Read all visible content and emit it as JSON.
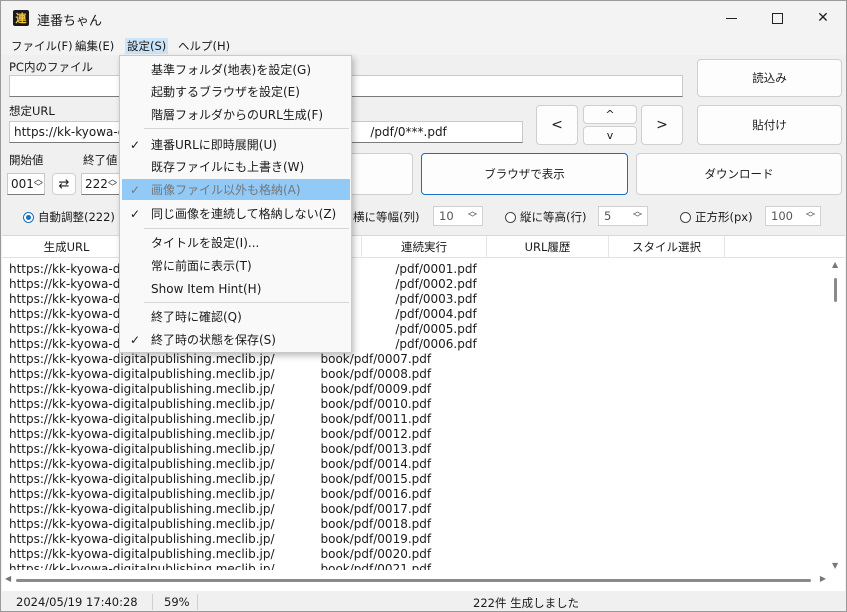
{
  "window": {
    "icon_char": "連",
    "title": "連番ちゃん"
  },
  "menubar": {
    "file": "ファイル(F)",
    "edit": "編集(E)",
    "settings": "設定(S)",
    "help": "ヘルプ(H)"
  },
  "form": {
    "pc_file_label": "PC内のファイル",
    "pc_file_value": "",
    "url_label": "想定URL",
    "url_value_left": "https://kk-kyowa-d",
    "url_value_right": "/pdf/0***.pdf",
    "start_label": "開始値",
    "start_value": "001",
    "end_label": "終了値",
    "end_value": "222",
    "swap_icon": "⇄"
  },
  "buttons": {
    "load": "読込み",
    "paste": "貼付け",
    "prev": "<",
    "up": "^",
    "down": "v",
    "next": ">",
    "browser": "ブラウザで表示",
    "download": "ダウンロード"
  },
  "layout_options": {
    "auto": "自動調整(222)",
    "equal_width_label": "横に等幅(列)",
    "equal_width_value": "10",
    "equal_height_label": "縦に等高(行)",
    "equal_height_value": "5",
    "square_label": "正方形(px)",
    "square_value": "100"
  },
  "table": {
    "columns": [
      "生成URL",
      "連続実行",
      "URL履歴",
      "スタイル選択"
    ],
    "rows_left": [
      "https://kk-kyowa-d",
      "https://kk-kyowa-d",
      "https://kk-kyowa-d",
      "https://kk-kyowa-d",
      "https://kk-kyowa-d",
      "https://kk-kyowa-d",
      "https://kk-kyowa-digitalpublishing.meclib.jp/",
      "https://kk-kyowa-digitalpublishing.meclib.jp/",
      "https://kk-kyowa-digitalpublishing.meclib.jp/",
      "https://kk-kyowa-digitalpublishing.meclib.jp/",
      "https://kk-kyowa-digitalpublishing.meclib.jp/",
      "https://kk-kyowa-digitalpublishing.meclib.jp/",
      "https://kk-kyowa-digitalpublishing.meclib.jp/",
      "https://kk-kyowa-digitalpublishing.meclib.jp/",
      "https://kk-kyowa-digitalpublishing.meclib.jp/",
      "https://kk-kyowa-digitalpublishing.meclib.jp/",
      "https://kk-kyowa-digitalpublishing.meclib.jp/",
      "https://kk-kyowa-digitalpublishing.meclib.jp/",
      "https://kk-kyowa-digitalpublishing.meclib.jp/",
      "https://kk-kyowa-digitalpublishing.meclib.jp/",
      "https://kk-kyowa-digitalpublishing.meclib.jp/"
    ],
    "rows_right": [
      "/pdf/0001.pdf",
      "/pdf/0002.pdf",
      "/pdf/0003.pdf",
      "/pdf/0004.pdf",
      "/pdf/0005.pdf",
      "/pdf/0006.pdf",
      "book/pdf/0007.pdf",
      "book/pdf/0008.pdf",
      "book/pdf/0009.pdf",
      "book/pdf/0010.pdf",
      "book/pdf/0011.pdf",
      "book/pdf/0012.pdf",
      "book/pdf/0013.pdf",
      "book/pdf/0014.pdf",
      "book/pdf/0015.pdf",
      "book/pdf/0016.pdf",
      "book/pdf/0017.pdf",
      "book/pdf/0018.pdf",
      "book/pdf/0019.pdf",
      "book/pdf/0020.pdf",
      "book/pdf/0021.pdf"
    ]
  },
  "status": {
    "datetime": "2024/05/19  17:40:28",
    "percent": "59%",
    "message": "222件 生成しました"
  },
  "settings_menu": {
    "items": [
      {
        "label": "基準フォルダ(地表)を設定(G)",
        "checked": false,
        "check": ""
      },
      {
        "label": "起動するブラウザを設定(E)",
        "checked": false,
        "check": ""
      },
      {
        "label": "階層フォルダからのURL生成(F)",
        "checked": false,
        "check": ""
      },
      {
        "label": "連番URLに即時展開(U)",
        "checked": true,
        "check": "✓"
      },
      {
        "label": "既存ファイルにも上書き(W)",
        "checked": false,
        "check": ""
      },
      {
        "label": "画像ファイル以外も格納(A)",
        "checked": true,
        "check": "✓"
      },
      {
        "label": "同じ画像を連続して格納しない(Z)",
        "checked": true,
        "check": "✓"
      },
      {
        "label": "タイトルを設定(I)...",
        "checked": false,
        "check": ""
      },
      {
        "label": "常に前面に表示(T)",
        "checked": false,
        "check": ""
      },
      {
        "label": "Show Item Hint(H)",
        "checked": false,
        "check": ""
      },
      {
        "label": "終了時に確認(Q)",
        "checked": false,
        "check": ""
      },
      {
        "label": "終了時の状態を保存(S)",
        "checked": true,
        "check": "✓"
      }
    ]
  },
  "colors": {
    "accent": "#1b6ec2",
    "menu_highlight": "#91c9f7"
  }
}
